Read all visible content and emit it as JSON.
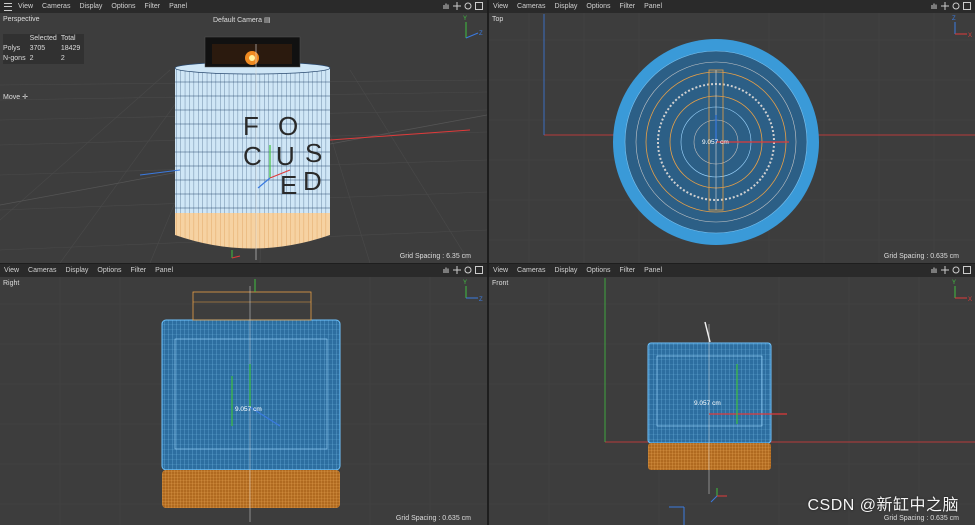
{
  "menu": [
    "View",
    "Cameras",
    "Display",
    "Options",
    "Filter",
    "Panel"
  ],
  "viewports": {
    "perspective": {
      "label": "Perspective",
      "camera": "Default Camera",
      "grid_spacing": "Grid Spacing : 6.35 cm",
      "stats": {
        "col_selected": "Selected",
        "col_total": "Total",
        "rows": [
          {
            "name": "Polys",
            "selected": "3705",
            "total": "18429"
          },
          {
            "name": "N-gons",
            "selected": "2",
            "total": "2"
          }
        ]
      },
      "tool": "Move",
      "model_text": [
        "F",
        "O",
        "C",
        "U",
        "S",
        "E",
        "D"
      ]
    },
    "top": {
      "label": "Top",
      "grid_spacing": "Grid Spacing : 0.635 cm",
      "measure": "9.057 cm"
    },
    "right": {
      "label": "Right",
      "grid_spacing": "Grid Spacing : 0.635 cm",
      "measure": "9.057 cm"
    },
    "front": {
      "label": "Front",
      "grid_spacing": "Grid Spacing : 0.635 cm",
      "measure": "9.057 cm"
    }
  },
  "axis_letters": {
    "y": "Y",
    "z": "Z",
    "x": "X"
  },
  "watermark": "CSDN @新缸中之脑",
  "icons": [
    "hamburger-icon",
    "hand-pan-icon",
    "move-arrows-icon",
    "rotate-icon",
    "maximize-icon",
    "camera-icon",
    "move-cross-icon"
  ],
  "colors": {
    "mesh_blue": "#3a9ad8",
    "mesh_orange": "#e8a047",
    "axis_red": "#e03a3a",
    "axis_green": "#40c040",
    "axis_blue": "#3a7ae0"
  }
}
